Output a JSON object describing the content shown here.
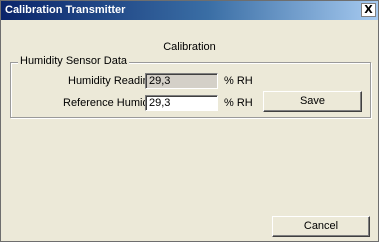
{
  "window": {
    "title": "Calibration Transmitter",
    "close_glyph": "X"
  },
  "heading": "Calibration",
  "group": {
    "label": "Humidity Sensor Data",
    "humidity_reading": {
      "label": "Humidity Reading",
      "value": "29,3",
      "unit": "% RH"
    },
    "reference_humidity": {
      "label": "Reference Humidity",
      "value": "29,3",
      "unit": "% RH"
    }
  },
  "buttons": {
    "save": "Save",
    "cancel": "Cancel"
  }
}
